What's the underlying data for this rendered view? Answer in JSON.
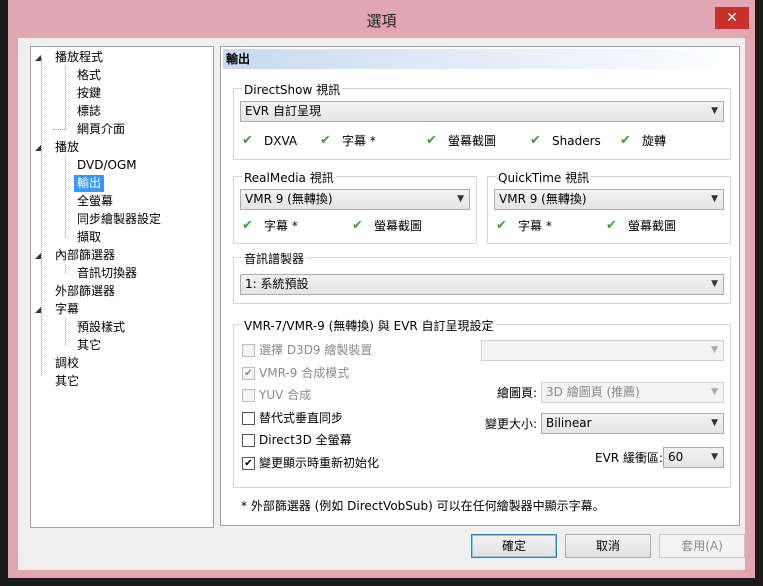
{
  "window": {
    "title": "選項",
    "close_glyph": "✕"
  },
  "tree": {
    "items": [
      {
        "label": "播放程式",
        "toggle": "◢"
      },
      {
        "label": "格式"
      },
      {
        "label": "按鍵"
      },
      {
        "label": "標誌"
      },
      {
        "label": "網頁介面"
      },
      {
        "label": "播放",
        "toggle": "◢"
      },
      {
        "label": "DVD/OGM"
      },
      {
        "label": "輸出",
        "selected": true
      },
      {
        "label": "全螢幕"
      },
      {
        "label": "同步繪製器設定"
      },
      {
        "label": "擷取"
      },
      {
        "label": "內部篩選器",
        "toggle": "◢"
      },
      {
        "label": "音訊切換器"
      },
      {
        "label": "外部篩選器"
      },
      {
        "label": "字幕",
        "toggle": "◢"
      },
      {
        "label": "預設樣式"
      },
      {
        "label": "其它"
      },
      {
        "label": "調校"
      },
      {
        "label": "其它"
      }
    ]
  },
  "panel": {
    "header": "輸出",
    "directshow": {
      "label": "DirectShow 視訊",
      "value": "EVR 自訂呈現",
      "features": [
        "DXVA",
        "字幕 *",
        "螢幕截圖",
        "Shaders",
        "旋轉"
      ]
    },
    "realmedia": {
      "label": "RealMedia 視訊",
      "value": "VMR 9 (無轉換)",
      "features": [
        "字幕 *",
        "螢幕截圖"
      ]
    },
    "quicktime": {
      "label": "QuickTime 視訊",
      "value": "VMR 9 (無轉換)",
      "features": [
        "字幕 *",
        "螢幕截圖"
      ]
    },
    "audio": {
      "label": "音訊譜製器",
      "value": "1: 系統預設"
    },
    "vmr": {
      "label": "VMR-7/VMR-9 (無轉換) 與 EVR 自訂呈現設定",
      "checks": [
        {
          "label": "選擇 D3D9 繪製裝置",
          "checked": false,
          "disabled": true
        },
        {
          "label": "VMR-9 合成模式",
          "checked": true,
          "disabled": true
        },
        {
          "label": "YUV 合成",
          "checked": false,
          "disabled": true
        },
        {
          "label": "替代式垂直同步",
          "checked": false,
          "disabled": false
        },
        {
          "label": "Direct3D 全螢幕",
          "checked": false,
          "disabled": false
        },
        {
          "label": "變更顯示時重新初始化",
          "checked": true,
          "disabled": false
        }
      ],
      "device_value": "",
      "surface_label": "繪圖頁:",
      "surface_value": "3D 繪圖頁 (推薦)",
      "resize_label": "變更大小:",
      "resize_value": "Bilinear",
      "evr_label": "EVR 緩衝區:",
      "evr_value": "60"
    },
    "note": "* 外部篩選器 (例如 DirectVobSub) 可以在任何繪製器中顯示字幕。"
  },
  "buttons": {
    "ok": "確定",
    "cancel": "取消",
    "apply": "套用(A)"
  },
  "glyphs": {
    "check": "✔",
    "tick": "✔",
    "dropdown": "▼"
  }
}
